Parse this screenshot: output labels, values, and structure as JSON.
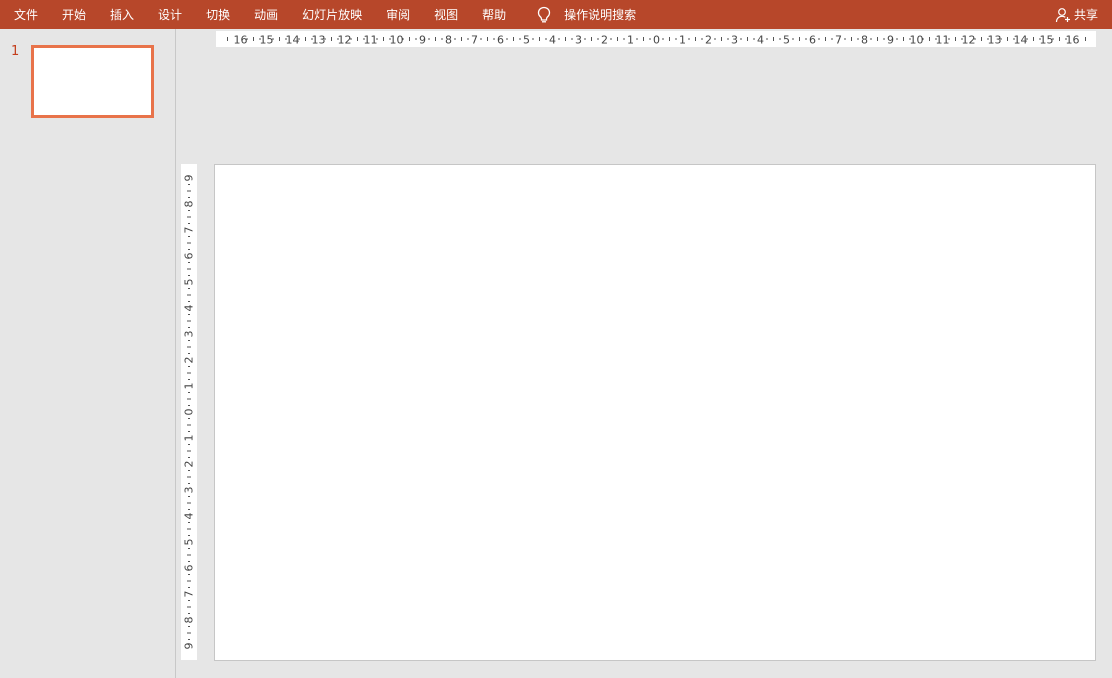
{
  "ribbon": {
    "tabs": [
      {
        "label": "文件"
      },
      {
        "label": "开始"
      },
      {
        "label": "插入"
      },
      {
        "label": "设计"
      },
      {
        "label": "切换"
      },
      {
        "label": "动画"
      },
      {
        "label": "幻灯片放映"
      },
      {
        "label": "审阅"
      },
      {
        "label": "视图"
      },
      {
        "label": "帮助"
      }
    ],
    "tell_me_label": "操作说明搜索",
    "tell_me_icon": "lightbulb-icon",
    "share_label": "共享",
    "share_icon": "person-add-icon",
    "color": "#b7472a"
  },
  "thumbnails": {
    "slides": [
      {
        "number": "1",
        "selected": true
      }
    ],
    "selected_border_color": "#e8734a",
    "number_color": "#c43e1c"
  },
  "rulers": {
    "horizontal_labels": [
      "16",
      "15",
      "14",
      "13",
      "12",
      "11",
      "10",
      "9",
      "8",
      "7",
      "6",
      "5",
      "4",
      "3",
      "2",
      "1",
      "0",
      "1",
      "2",
      "3",
      "4",
      "5",
      "6",
      "7",
      "8",
      "9",
      "10",
      "11",
      "12",
      "13",
      "14",
      "15",
      "16"
    ],
    "vertical_labels": [
      "9",
      "8",
      "7",
      "6",
      "5",
      "4",
      "3",
      "2",
      "1",
      "0",
      "1",
      "2",
      "3",
      "4",
      "5",
      "6",
      "7",
      "8",
      "9"
    ]
  },
  "slide": {
    "background": "#ffffff"
  }
}
